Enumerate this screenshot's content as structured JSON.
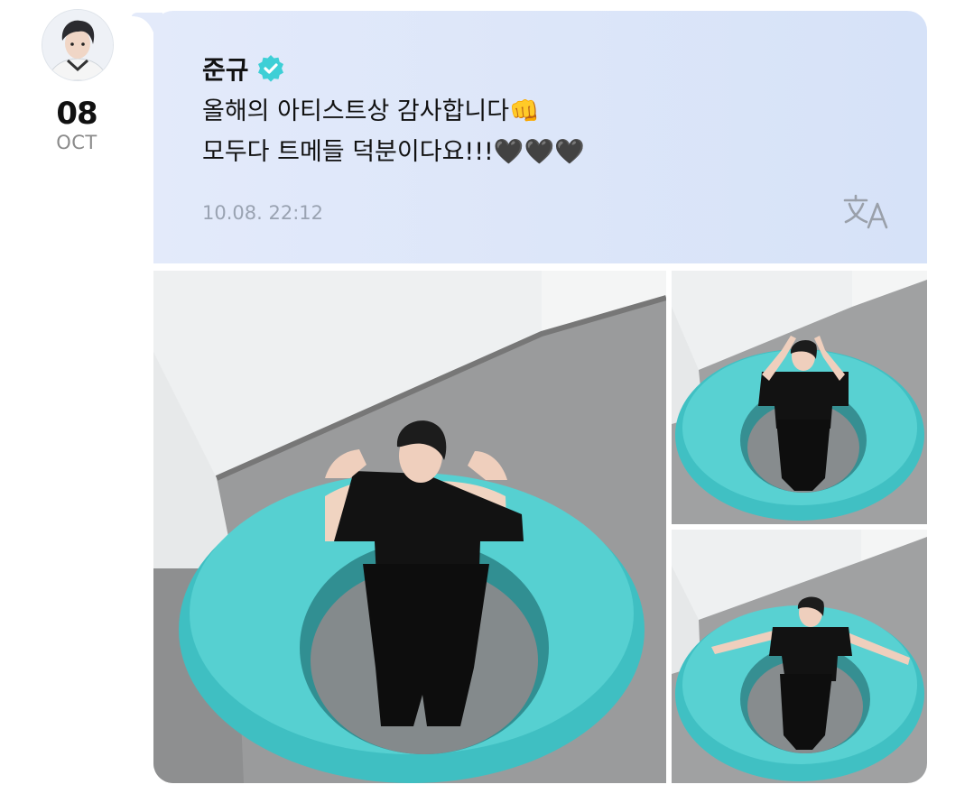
{
  "post": {
    "author": "준규",
    "date_day": "08",
    "date_month": "OCT",
    "message_line1": "올해의 아티스트상 감사합니다👊",
    "message_line2": "모두다 트메들 덕분이다요!!!🖤🖤🖤",
    "timestamp": "10.08. 22:12"
  },
  "icons": {
    "verified": "verified-check-icon",
    "translate": "translate-icon"
  },
  "colors": {
    "bubble": "#dbe5f8",
    "verified": "#3ecfd6",
    "timestamp": "#9aa3b2",
    "ring": "#45c4c6"
  }
}
